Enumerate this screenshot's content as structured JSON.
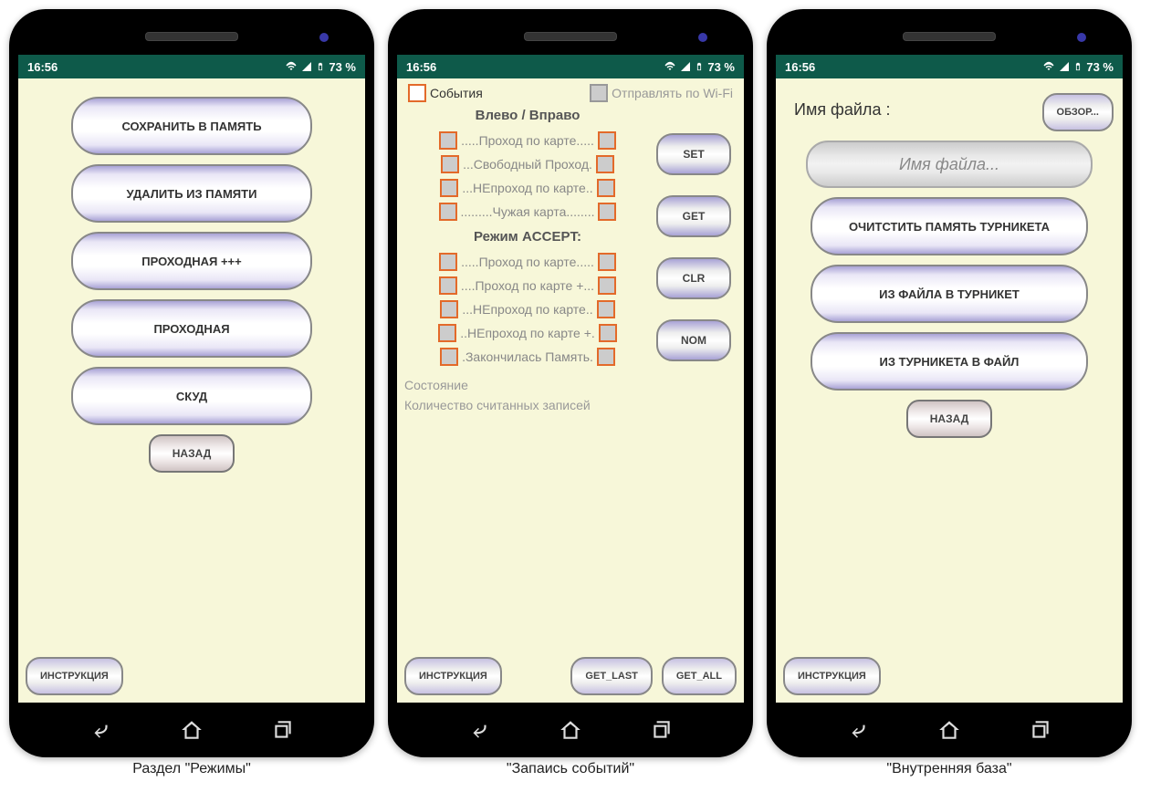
{
  "status": {
    "time": "16:56",
    "battery": "73 %"
  },
  "captions": {
    "modes": "Раздел \"Режимы\"",
    "events": "\"Запаись событий\"",
    "database": "\"Внутренняя база\""
  },
  "common": {
    "back": "НАЗАД",
    "instruction": "ИНСТРУКЦИЯ"
  },
  "modes": {
    "buttons": [
      "СОХРАНИТЬ В ПАМЯТЬ",
      "УДАЛИТЬ ИЗ ПАМЯТИ",
      "ПРОХОДНАЯ +++",
      "ПРОХОДНАЯ",
      "СКУД"
    ]
  },
  "events": {
    "events_cb": "События",
    "wifi_cb": "Отправлять по Wi-Fi",
    "section1_title": "Влево / Вправо",
    "section1_rows": [
      ".....Проход по карте.....",
      "...Свободный Проход.",
      "...НЕпроход по карте..",
      ".........Чужая карта........"
    ],
    "section2_title": "Режим ACCEPT:",
    "section2_rows": [
      ".....Проход по карте.....",
      "....Проход по карте +...",
      "...НЕпроход по карте..",
      "..НЕпроход по карте +.",
      ".Закончилась Память."
    ],
    "status_label": "Состояние",
    "count_label": "Количество считанных записей",
    "side": {
      "set": "SET",
      "get": "GET",
      "clr": "CLR",
      "nom": "NOM"
    },
    "bottom": {
      "get_last": "GET_LAST",
      "get_all": "GET_ALL"
    }
  },
  "database": {
    "filename_label": "Имя файла :",
    "browse": "ОБЗОР...",
    "placeholder": "Имя файла...",
    "buttons": [
      "ОЧИТСТИТЬ ПАМЯТЬ ТУРНИКЕТА",
      "ИЗ ФАЙЛА В ТУРНИКЕТ",
      "ИЗ ТУРНИКЕТА В ФАЙЛ"
    ]
  }
}
